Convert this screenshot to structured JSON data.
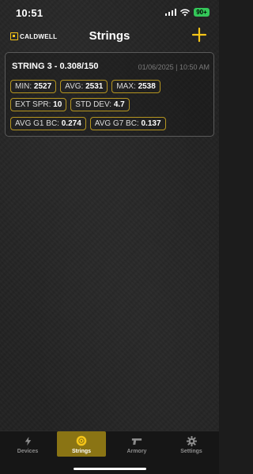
{
  "status_bar": {
    "time": "10:51",
    "battery": "90+"
  },
  "header": {
    "logo_text": "CALDWELL",
    "title": "Strings",
    "add_icon": "plus-icon"
  },
  "string_card": {
    "title": "STRING 3 - 0.308/150",
    "date": "01/06/2025 | 10:50 AM",
    "stats_row1": [
      {
        "label": "MIN:",
        "value": "2527"
      },
      {
        "label": "AVG:",
        "value": "2531"
      },
      {
        "label": "MAX:",
        "value": "2538"
      }
    ],
    "stats_row2": [
      {
        "label": "EXT SPR:",
        "value": "10"
      },
      {
        "label": "STD DEV:",
        "value": "4.7"
      }
    ],
    "stats_row3": [
      {
        "label": "AVG G1 BC:",
        "value": "0.274"
      },
      {
        "label": "AVG G7 BC:",
        "value": "0.137"
      }
    ]
  },
  "tab_bar": {
    "tabs": [
      {
        "label": "Devices",
        "icon": "lightning-icon"
      },
      {
        "label": "Strings",
        "icon": "target-icon",
        "active": true
      },
      {
        "label": "Armory",
        "icon": "pistol-icon"
      },
      {
        "label": "Settings",
        "icon": "gear-icon"
      }
    ]
  },
  "colors": {
    "accent": "#f5c518",
    "active_tab": "#8a7414",
    "background": "#222222"
  }
}
